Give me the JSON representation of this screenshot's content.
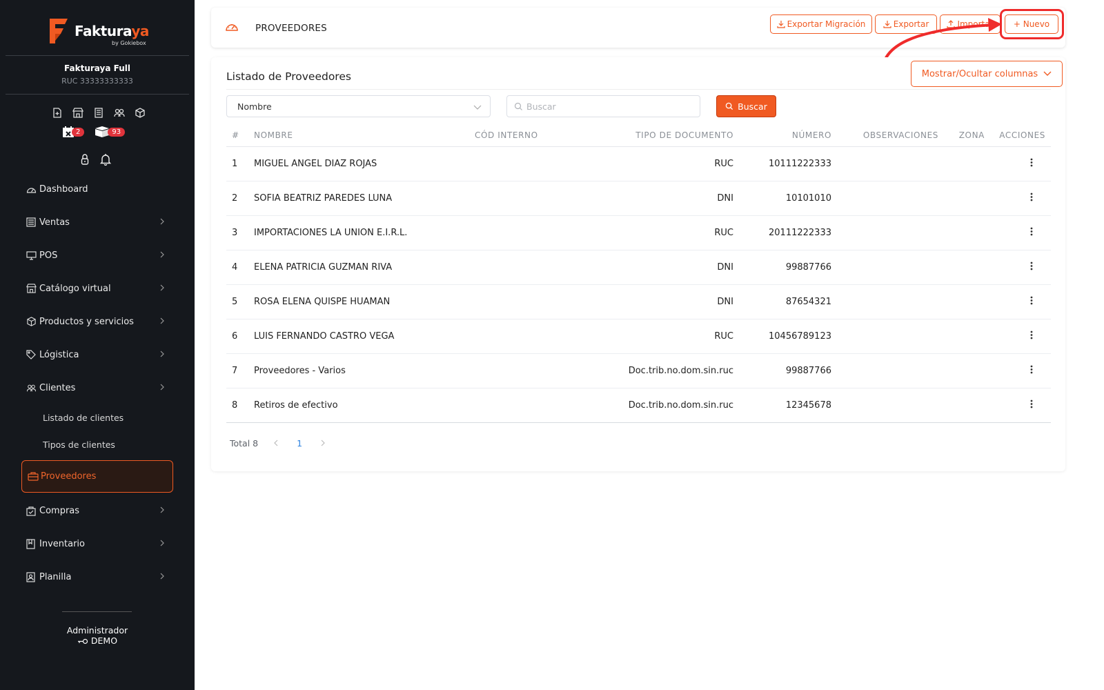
{
  "sidebar": {
    "logo": {
      "brand": "Fakturaya",
      "brand_main": "Faktura",
      "brand_accent": "ya",
      "byline": "by Gokiebox"
    },
    "company_name": "Fakturaya Full",
    "ruc": "RUC 33333333333",
    "quick_icons": [
      "document-add-icon",
      "store-icon",
      "receipt-icon",
      "users-icon",
      "box-icon"
    ],
    "badges": [
      {
        "icon": "calendar-x-icon",
        "count": "2"
      },
      {
        "icon": "boxes-icon",
        "count": "93"
      }
    ],
    "utility_icons": [
      "lock-icon",
      "bell-icon"
    ],
    "items": [
      {
        "label": "Dashboard",
        "icon": "dashboard-icon"
      },
      {
        "label": "Ventas",
        "icon": "sales-icon"
      },
      {
        "label": "POS",
        "icon": "monitor-icon"
      },
      {
        "label": "Catálogo virtual",
        "icon": "store-icon"
      },
      {
        "label": "Productos y servicios",
        "icon": "box-icon"
      },
      {
        "label": "Lógistica",
        "icon": "tag-icon"
      },
      {
        "label": "Clientes",
        "icon": "users-icon"
      },
      {
        "label": "Proveedores",
        "icon": "briefcase-icon"
      },
      {
        "label": "Compras",
        "icon": "bag-icon"
      },
      {
        "label": "Inventario",
        "icon": "book-icon"
      },
      {
        "label": "Planilla",
        "icon": "id-card-icon"
      }
    ],
    "clientes_sub": [
      "Listado de clientes",
      "Tipos de clientes"
    ],
    "user_name": "Administrador",
    "user_role": "DEMO"
  },
  "header": {
    "title": "PROVEEDORES",
    "buttons": {
      "export_migration": "Exportar Migración",
      "export": "Exportar",
      "import": "Importar",
      "new": "+ Nuevo"
    }
  },
  "main": {
    "list_title": "Listado de Proveedores",
    "columns_button": "Mostrar/Ocultar columnas",
    "filter_field": "Nombre",
    "search_placeholder": "Buscar",
    "search_button": "Buscar",
    "table": {
      "headers": [
        "#",
        "NOMBRE",
        "CÓD INTERNO",
        "TIPO DE DOCUMENTO",
        "NÚMERO",
        "OBSERVACIONES",
        "ZONA",
        "ACCIONES"
      ],
      "rows": [
        {
          "n": "1",
          "nombre": "MIGUEL ANGEL DIAZ ROJAS",
          "cod": "",
          "tipo": "RUC",
          "numero": "10111222333",
          "obs": "",
          "zona": ""
        },
        {
          "n": "2",
          "nombre": "SOFIA BEATRIZ PAREDES LUNA",
          "cod": "",
          "tipo": "DNI",
          "numero": "10101010",
          "obs": "",
          "zona": ""
        },
        {
          "n": "3",
          "nombre": "IMPORTACIONES LA UNION E.I.R.L.",
          "cod": "",
          "tipo": "RUC",
          "numero": "20111222333",
          "obs": "",
          "zona": ""
        },
        {
          "n": "4",
          "nombre": "ELENA PATRICIA GUZMAN RIVA",
          "cod": "",
          "tipo": "DNI",
          "numero": "99887766",
          "obs": "",
          "zona": ""
        },
        {
          "n": "5",
          "nombre": "ROSA ELENA QUISPE HUAMAN",
          "cod": "",
          "tipo": "DNI",
          "numero": "87654321",
          "obs": "",
          "zona": ""
        },
        {
          "n": "6",
          "nombre": "LUIS FERNANDO CASTRO VEGA",
          "cod": "",
          "tipo": "RUC",
          "numero": "10456789123",
          "obs": "",
          "zona": ""
        },
        {
          "n": "7",
          "nombre": "Proveedores - Varios",
          "cod": "",
          "tipo": "Doc.trib.no.dom.sin.ruc",
          "numero": "99887766",
          "obs": "",
          "zona": ""
        },
        {
          "n": "8",
          "nombre": "Retiros de efectivo",
          "cod": "",
          "tipo": "Doc.trib.no.dom.sin.ruc",
          "numero": "12345678",
          "obs": "",
          "zona": ""
        }
      ]
    },
    "pagination": {
      "total": "Total 8",
      "current_page": "1"
    }
  },
  "colors": {
    "accent": "#f05a22",
    "sidebar_bg": "#15181d",
    "badge": "#e0343c",
    "callout": "#ef2b2b",
    "link": "#2d82e0"
  }
}
